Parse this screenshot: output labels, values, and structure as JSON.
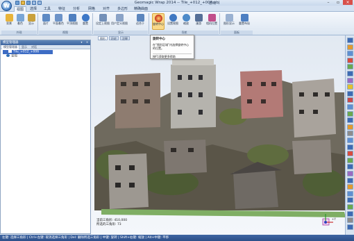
{
  "window": {
    "title": "Geomagic Wrap 2014 -- Tile_+012_+006.obj",
    "gaming_tag": "游戏",
    "app_button": "W",
    "controls": [
      "minimize",
      "restore",
      "close"
    ]
  },
  "ribbon_tabs": [
    "视图",
    "选择",
    "工具",
    "特征",
    "分析",
    "网格",
    "对齐",
    "多边形",
    "精确曲面"
  ],
  "active_tab": "视图",
  "ribbon": {
    "buttons": [
      {
        "label": "背景",
        "icon": "background-icon",
        "color": "#e8b43a"
      },
      {
        "label": "着色",
        "icon": "shading-icon",
        "color": "#7aa6d6"
      },
      {
        "label": "显示",
        "icon": "display-icon",
        "color": "#c9a13c"
      },
      {
        "label": "面片",
        "icon": "facet-icon",
        "color": "#5d8ac4"
      },
      {
        "label": "平面着色",
        "icon": "flat-shading-icon",
        "color": "#6c93c8"
      },
      {
        "label": "平顶视图",
        "icon": "top-view-icon",
        "color": "#4f7fbf"
      },
      {
        "label": "重置",
        "icon": "reset-icon",
        "color": "#3d78c7"
      },
      {
        "label": "设定上视图",
        "icon": "set-up-view-icon",
        "color": "#7390b8"
      },
      {
        "label": "用户定义视图",
        "icon": "user-view-icon",
        "color": "#8aa3c7"
      },
      {
        "label": "适合于",
        "icon": "fit-icon",
        "color": "#5c86bd"
      },
      {
        "label": "旋转中心",
        "icon": "rotation-center-icon",
        "color": "#d44a2a"
      },
      {
        "label": "设置视图",
        "icon": "set-view-icon",
        "color": "#3f78c2"
      },
      {
        "label": "缩放",
        "icon": "zoom-icon",
        "color": "#4c8ac9"
      },
      {
        "label": "漫游",
        "icon": "walk-icon",
        "color": "#556f97"
      },
      {
        "label": "相机位置",
        "icon": "camera-position-icon",
        "color": "#c14f8b"
      },
      {
        "label": "图形显示",
        "icon": "graphics-display-icon",
        "color": "#9ab1d1"
      },
      {
        "label": "重置布局",
        "icon": "reset-layout-icon",
        "color": "#4d7fc2"
      }
    ],
    "pressed": "旋转中心",
    "groups": [
      "外观",
      "视图",
      "显示",
      "导航",
      "面板"
    ]
  },
  "tooltip": {
    "title": "旋转中心",
    "body": "在“图形区域”内选择旋转中心的位置。",
    "help": "按F1获取更多帮助"
  },
  "model_manager": {
    "title": "模型管理器",
    "tabs": [
      "模型管理器",
      "显示",
      "对话"
    ],
    "items": [
      {
        "label": "Tile_+012_+006",
        "selected": true
      },
      {
        "label": "全局",
        "selected": false
      }
    ]
  },
  "viewport": {
    "tabs": [
      "图形",
      "历史",
      "注释"
    ],
    "stats": {
      "triangles": "当前三角形: 410,000",
      "selected": "所选的三角形: 73"
    },
    "axis_label": "+Y"
  },
  "right_toolbar_colors": [
    "#3d6bb3",
    "#e19a2f",
    "#5e8fd1",
    "#d84c3e",
    "#6aa84f",
    "#3d6bb3",
    "#9a6bc2",
    "#e1c12f",
    "#3d6bb3",
    "#c94a4a",
    "#5e8fd1",
    "#6aa84f",
    "#3d6bb3",
    "#e19a2f",
    "#8c8c8c",
    "#5e8fd1",
    "#3d6bb3",
    "#d84c3e",
    "#6aa84f",
    "#3d6bb3",
    "#9a6bc2",
    "#3d6bb3",
    "#e19a2f",
    "#5e8fd1",
    "#3d6bb3",
    "#6aa84f",
    "#3d6bb3",
    "#8c8c8c",
    "#3d6bb3"
  ],
  "statusbar": {
    "text": "左键: 选择三角形 | Ctrl+左键: 取消选择三角形 | Del: 删除所选三角形 | 中键: 旋转 | Shift+右键: 缩放 | Alt+中键: 平移"
  }
}
